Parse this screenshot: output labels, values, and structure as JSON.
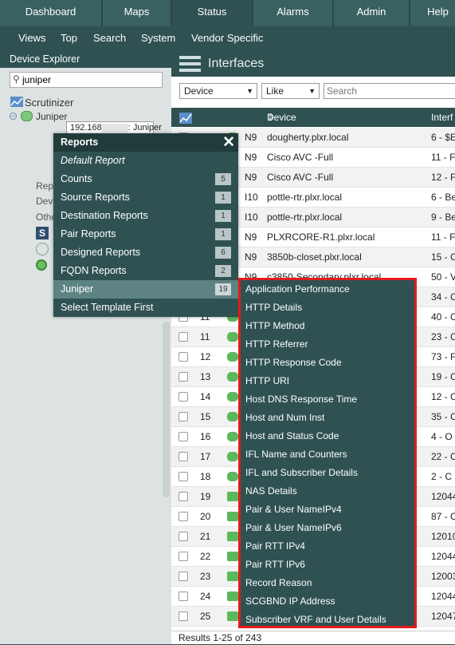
{
  "top_nav": [
    "Dashboard",
    "Maps",
    "Status",
    "Alarms",
    "Admin",
    "Help"
  ],
  "sub_nav": [
    "Views",
    "Top",
    "Search",
    "System",
    "Vendor Specific"
  ],
  "sidebar": {
    "title": "Device Explorer",
    "search_value": "juniper",
    "tree_root": "Scrutinizer",
    "tree_node": "Juniper",
    "tree_children_partial": [
      "Rep",
      "Devi",
      "Othe"
    ],
    "tooltip_ip_prefix": "192.168",
    "tooltip_name": ": Juniper"
  },
  "main": {
    "title": "Interfaces",
    "filter_field": "Device",
    "filter_op": "Like",
    "search_placeholder": "Search",
    "columns": [
      "Device",
      "Interf"
    ],
    "rows": [
      {
        "num": "",
        "type": "N9",
        "device": "dougherty.plxr.local",
        "intf": "6 - $E"
      },
      {
        "num": "",
        "type": "N9",
        "device": "Cisco AVC -Full",
        "intf": "11 - F"
      },
      {
        "num": "",
        "type": "N9",
        "device": "Cisco AVC -Full",
        "intf": "12 - F"
      },
      {
        "num": "",
        "type": "I10",
        "device": "pottle-rtr.plxr.local",
        "intf": "6 - Be"
      },
      {
        "num": "",
        "type": "I10",
        "device": "pottle-rtr.plxr.local",
        "intf": "9 - Be"
      },
      {
        "num": "",
        "type": "N9",
        "device": "PLXRCORE-R1.plxr.local",
        "intf": "11 - F"
      },
      {
        "num": "",
        "type": "N9",
        "device": "3850b-closet.plxr.local",
        "intf": "15 - C"
      },
      {
        "num": "",
        "type": "N9",
        "device": "c3850-Secondary.plxr.local",
        "intf": "50 - V"
      },
      {
        "num": "",
        "type": "",
        "device": "",
        "intf": "34 - C"
      },
      {
        "num": "11",
        "type": "",
        "device": "",
        "intf": "40 - C"
      },
      {
        "num": "11",
        "type": "",
        "device": "",
        "intf": "23 - C"
      },
      {
        "num": "12",
        "type": "",
        "device": "",
        "intf": "73 - F"
      },
      {
        "num": "13",
        "type": "",
        "device": "",
        "intf": "19 - C"
      },
      {
        "num": "14",
        "type": "",
        "device": "",
        "intf": "12 - C"
      },
      {
        "num": "15",
        "type": "",
        "device": "",
        "intf": "35 - C"
      },
      {
        "num": "16",
        "type": "",
        "device": "",
        "intf": "4 - O"
      },
      {
        "num": "17",
        "type": "",
        "device": "",
        "intf": "22 - C"
      },
      {
        "num": "18",
        "type": "",
        "device": "",
        "intf": "2 - C"
      },
      {
        "num": "19",
        "type": "",
        "device": "",
        "intf": "12044"
      },
      {
        "num": "20",
        "type": "",
        "device": "",
        "intf": "87 - C"
      },
      {
        "num": "21",
        "type": "",
        "device": "",
        "intf": "12010"
      },
      {
        "num": "22",
        "type": "",
        "device": "",
        "intf": "12044"
      },
      {
        "num": "23",
        "type": "",
        "device": "",
        "intf": "12003"
      },
      {
        "num": "24",
        "type": "",
        "device": "",
        "intf": "12044"
      },
      {
        "num": "25",
        "type": "",
        "device": "",
        "intf": "12047"
      }
    ],
    "footer": "Results 1-25 of 243"
  },
  "reports_menu": {
    "title": "Reports",
    "close_glyph": "✕",
    "items": [
      {
        "label": "Default Report",
        "count": ""
      },
      {
        "label": "Counts",
        "count": "5"
      },
      {
        "label": "Source Reports",
        "count": "1"
      },
      {
        "label": "Destination Reports",
        "count": "1"
      },
      {
        "label": "Pair Reports",
        "count": "1"
      },
      {
        "label": "Designed Reports",
        "count": "6"
      },
      {
        "label": "FQDN Reports",
        "count": "2"
      },
      {
        "label": "Juniper",
        "count": "19"
      },
      {
        "label": "Select Template First",
        "count": ""
      }
    ]
  },
  "juniper_submenu": [
    "Application Performance",
    "HTTP Details",
    "HTTP Method",
    "HTTP Referrer",
    "HTTP Response Code",
    "HTTP URI",
    "Host DNS Response Time",
    "Host and Num Inst",
    "Host and Status Code",
    "IFL Name and Counters",
    "IFL and Subscriber Details",
    "NAS Details",
    "Pair & User NameIPv4",
    "Pair & User NameIPv6",
    "Pair RTT IPv4",
    "Pair RTT IPv6",
    "Record Reason",
    "SCGBND IP Address",
    "Subscriber VRF and User Details"
  ],
  "colors": {
    "accent": "#2f5151",
    "highlight_border": "#e31b1b",
    "status_green": "#5cb85c"
  }
}
